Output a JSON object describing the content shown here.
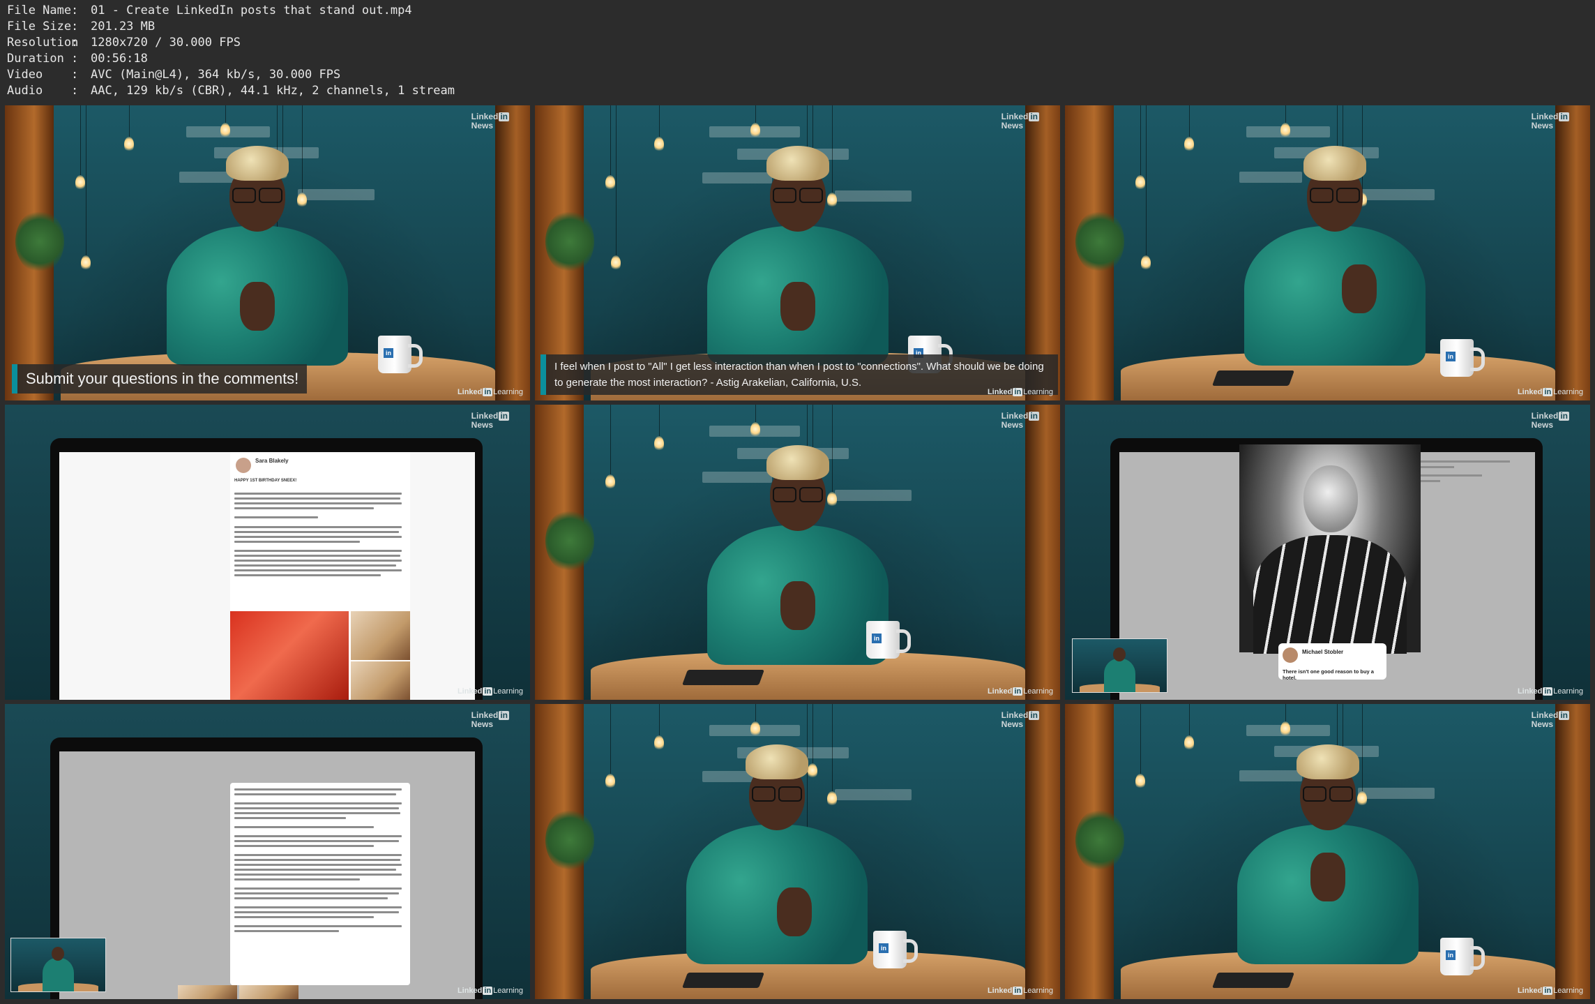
{
  "info": [
    {
      "key": "File Name",
      "value": "01 - Create LinkedIn posts that stand out.mp4"
    },
    {
      "key": "File Size",
      "value": "201.23 MB"
    },
    {
      "key": "Resolution",
      "value": "1280x720 / 30.000 FPS"
    },
    {
      "key": "Duration",
      "value": "00:56:18"
    },
    {
      "key": "Video",
      "value": "AVC (Main@L4), 364 kb/s, 30.000 FPS"
    },
    {
      "key": "Audio",
      "value": "AAC, 129 kb/s (CBR), 44.1 kHz, 2 channels, 1 stream"
    }
  ],
  "brand": {
    "linked": "Linked",
    "in": "in",
    "news": "News",
    "learning": "Learning"
  },
  "captions": {
    "submit": "Submit your questions in the comments!",
    "question": "I feel when I post to \"All\" I get less interaction than when I post to \"connections\". What should we be doing to generate the most interaction? - Astig Arakelian, California, U.S."
  },
  "post1": {
    "author": "Sara Blakely",
    "headline": "HAPPY 1ST BIRTHDAY SNEEX!"
  },
  "card": {
    "name": "Michael Stobler",
    "quote": "There isn't one good reason to buy a hotel."
  },
  "mug_logo": "in",
  "colors": {
    "accent": "#0b8f9c",
    "background": "#2c2c2c",
    "studio": "#1d4c57"
  }
}
